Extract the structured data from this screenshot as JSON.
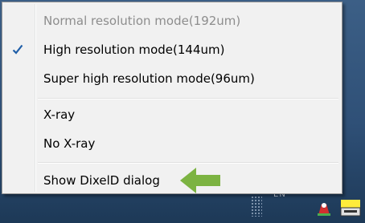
{
  "menu": {
    "items": [
      {
        "label": "Normal resolution mode(192um)",
        "enabled": false,
        "checked": false
      },
      {
        "label": "High resolution mode(144um)",
        "enabled": true,
        "checked": true
      },
      {
        "label": "Super high resolution mode(96um)",
        "enabled": true,
        "checked": false
      },
      {
        "label": "X-ray",
        "enabled": true,
        "checked": false
      },
      {
        "label": "No X-ray",
        "enabled": true,
        "checked": false
      },
      {
        "label": "Show DixelD dialog",
        "enabled": true,
        "checked": false
      }
    ]
  },
  "annotation": {
    "arrow_color": "#7cb342",
    "points_to": "Show DixelD dialog"
  },
  "tray": {
    "language": "EN"
  },
  "colors": {
    "menu_background": "#f1f1f1",
    "disabled_text": "#8d8d8d",
    "check_color": "#1f5ea8",
    "taskbar": "#2f5077"
  },
  "icons": {
    "check": "checkmark-icon",
    "annotation": "green-arrow-icon",
    "tray_grip": "tray-grip-icon",
    "tray_flag": "flag-tray-icon",
    "tray_device": "device-tray-icon"
  }
}
